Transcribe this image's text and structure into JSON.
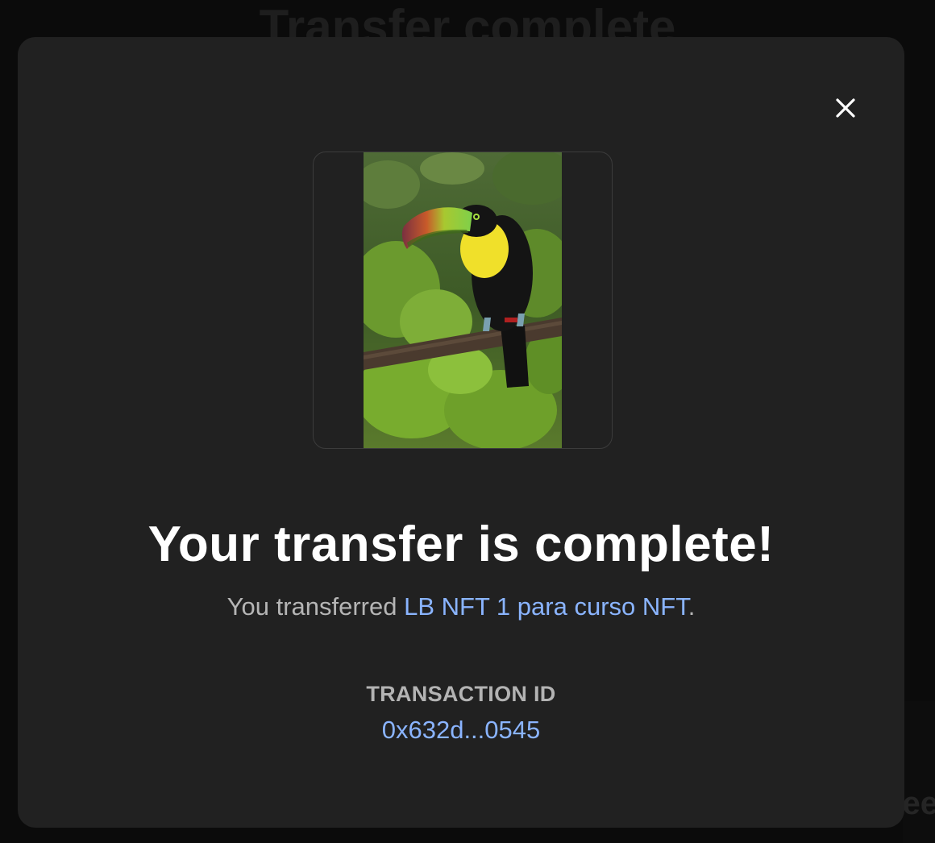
{
  "background": {
    "page_title": "Transfer complete",
    "right_edge_text": "ee"
  },
  "modal": {
    "close_icon": "close-icon",
    "nft_image_subject": "toucan-on-branch",
    "headline": "Your transfer is complete!",
    "subline_prefix": "You transferred ",
    "nft_name": "LB NFT 1 para curso NFT",
    "subline_suffix": ".",
    "transaction_label": "TRANSACTION ID",
    "transaction_id": "0x632d...0545"
  },
  "colors": {
    "modal_bg": "#212121",
    "link": "#8ab4ff",
    "headline": "#ffffff",
    "muted": "#b5b5b5"
  }
}
